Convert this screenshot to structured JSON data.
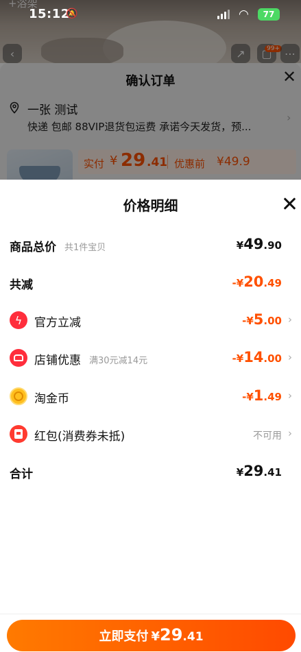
{
  "status_bar": {
    "time": "15:12",
    "battery": "77"
  },
  "background": {
    "title_peek": "+浴架",
    "cart_badge": "99+",
    "order_title": "确认订单",
    "address_name": "一张 测试",
    "address_detail": "快递 包邮 88VIP退货包运费 承诺今天发货，预...",
    "paid_label": "实付",
    "paid_symbol": "¥",
    "paid_int": "29",
    "paid_dec": ".41",
    "before_discount_label": "优惠前",
    "before_discount_value": "¥49.9"
  },
  "sheet": {
    "title": "价格明细",
    "rows": {
      "total_goods": {
        "label": "商品总价",
        "hint": "共1件宝贝",
        "sym": "¥",
        "int": "49",
        "dec": ".90"
      },
      "total_reduce": {
        "label": "共减",
        "sym": "-¥",
        "int": "20",
        "dec": ".49"
      },
      "official": {
        "label": "官方立减",
        "sym": "-¥",
        "int": "5",
        "dec": ".00",
        "icon": "lightning-icon"
      },
      "shop": {
        "label": "店铺优惠",
        "hint": "满30元减14元",
        "sym": "-¥",
        "int": "14",
        "dec": ".00",
        "icon": "shop-icon"
      },
      "coin": {
        "label": "淘金币",
        "sym": "-¥",
        "int": "1",
        "dec": ".49",
        "icon": "coin-icon"
      },
      "redpacket": {
        "label": "红包(消费券未抵)",
        "status": "不可用",
        "icon": "red-packet-icon"
      },
      "sum": {
        "label": "合计",
        "sym": "¥",
        "int": "29",
        "dec": ".41"
      }
    },
    "pay_button": {
      "label": "立即支付",
      "sym": "¥",
      "int": "29",
      "dec": ".41"
    }
  },
  "colors": {
    "accent": "#ff5000",
    "button_gradient_start": "#ff7a00",
    "button_gradient_end": "#ff4a00"
  }
}
